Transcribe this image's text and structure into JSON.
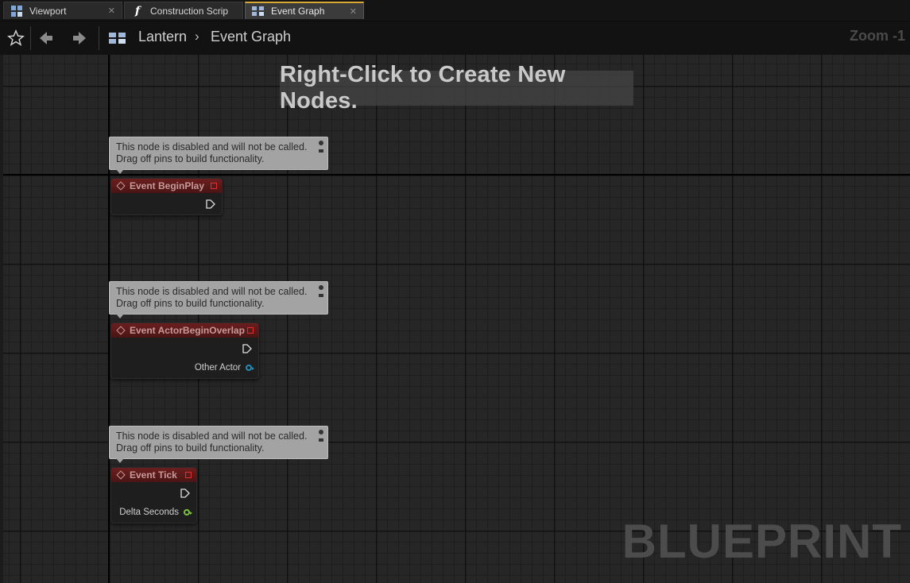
{
  "tabs": [
    {
      "label": "Viewport",
      "icon": "viewport-icon",
      "active": false
    },
    {
      "label": "Construction Scrip",
      "icon": "function-icon",
      "active": false
    },
    {
      "label": "Event Graph",
      "icon": "event-graph-icon",
      "active": true
    }
  ],
  "toolbar": {
    "breadcrumb_root": "Lantern",
    "breadcrumb_current": "Event Graph",
    "zoom": "Zoom -1"
  },
  "graph": {
    "hint": "Right-Click to Create New Nodes.",
    "watermark": "BLUEPRINT"
  },
  "comment_text": {
    "line1": "This node is disabled and will not be called.",
    "line2": "Drag off pins to build functionality."
  },
  "nodes": [
    {
      "title": "Event BeginPlay",
      "pins": []
    },
    {
      "title": "Event ActorBeginOverlap",
      "pins": [
        {
          "label": "Other Actor",
          "color": "#1f8fb8"
        }
      ]
    },
    {
      "title": "Event Tick",
      "pins": [
        {
          "label": "Delta Seconds",
          "color": "#7ac43a"
        }
      ]
    }
  ],
  "colors": {
    "event_header": "#6b1e1e",
    "object_pin": "#1f8fb8",
    "float_pin": "#7ac43a",
    "comment_bg": "#a3a3a3",
    "active_tab_accent": "#d8a830"
  }
}
